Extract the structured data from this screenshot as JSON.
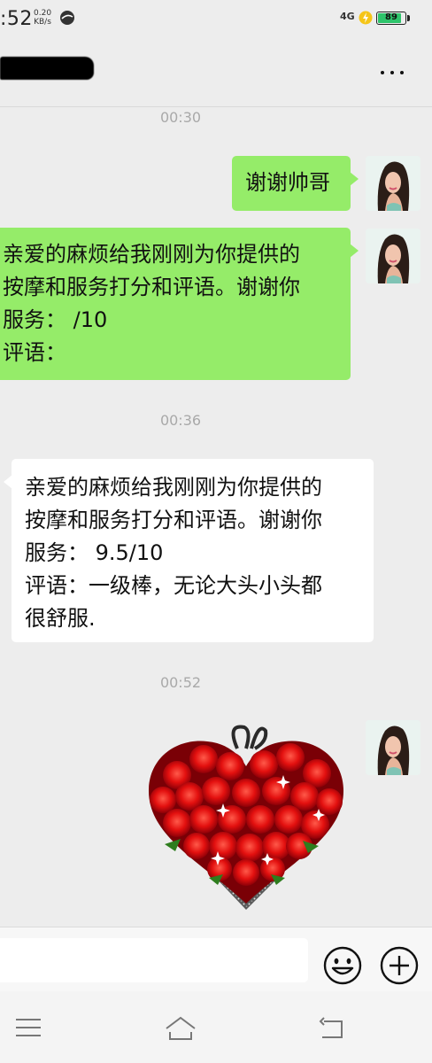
{
  "status_bar": {
    "time": ":52",
    "net_speed_value": "0.20",
    "net_speed_unit": "KB/s",
    "network": "4G",
    "battery": "89",
    "battery_level": 0.89,
    "battery_color": "#2ec46b"
  },
  "header": {
    "more_icon": "more-dots-icon"
  },
  "messages": [
    {
      "time": "00:30"
    },
    {
      "direction": "out",
      "lines": [
        "谢谢帅哥"
      ]
    },
    {
      "direction": "out",
      "lines": [
        "亲爱的麻烦给我刚刚为你提供的",
        "按摩和服务打分和评语。谢谢你",
        "服务：  /10",
        "评语："
      ]
    },
    {
      "time": "00:36"
    },
    {
      "direction": "in",
      "lines": [
        "亲爱的麻烦给我刚刚为你提供的",
        "按摩和服务打分和评语。谢谢你",
        "服务：  9.5/10",
        "评语：一级棒，无论大头小头都",
        "很舒服."
      ]
    },
    {
      "time": "00:52"
    },
    {
      "direction": "out",
      "sticker": "red-rose-heart"
    }
  ],
  "colors": {
    "outgoing_bubble": "#95ec69",
    "incoming_bubble": "#ffffff",
    "background": "#ededed"
  },
  "input_bar": {
    "emoji_icon": "emoji-icon",
    "plus_icon": "plus-icon"
  },
  "nav_bar": {
    "icons": [
      "menu-icon",
      "home-icon",
      "back-icon"
    ]
  }
}
